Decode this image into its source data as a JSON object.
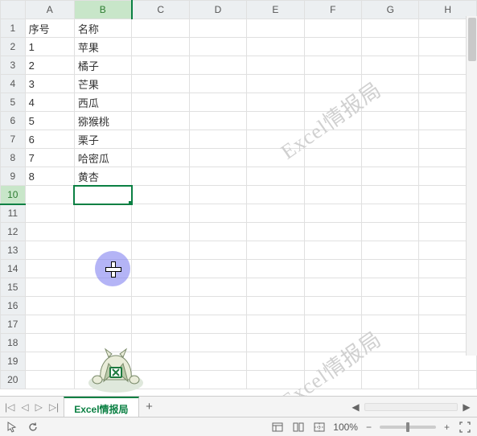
{
  "columns": [
    "A",
    "B",
    "C",
    "D",
    "E",
    "F",
    "G",
    "H"
  ],
  "row_count": 20,
  "selected": {
    "row": 10,
    "col": "B",
    "col_index": 1
  },
  "cells": {
    "A1": "序号",
    "B1": "名称",
    "A2": "1",
    "B2": "苹果",
    "A3": "2",
    "B3": "橘子",
    "A4": "3",
    "B4": "芒果",
    "A5": "4",
    "B5": "西瓜",
    "A6": "5",
    "B6": "猕猴桃",
    "A7": "6",
    "B7": "栗子",
    "A8": "7",
    "B8": "哈密瓜",
    "A9": "8",
    "B9": "黄杏"
  },
  "watermark": "Excel情报局",
  "sheet_tab": {
    "name": "Excel情报局",
    "add_label": "+"
  },
  "tab_nav": {
    "first": "|◁",
    "prev": "◁",
    "next": "▷",
    "last": "▷|"
  },
  "status": {
    "zoom_text": "100%",
    "zoom_minus": "−",
    "zoom_plus": "+"
  },
  "icons": {
    "pointer": "pointer-icon",
    "reload": "reload-icon",
    "view_normal": "view-normal-icon",
    "view_page": "view-page-icon",
    "view_break": "view-break-icon",
    "fullscreen": "fullscreen-icon",
    "scroll_left": "◀",
    "scroll_right": "▶"
  }
}
